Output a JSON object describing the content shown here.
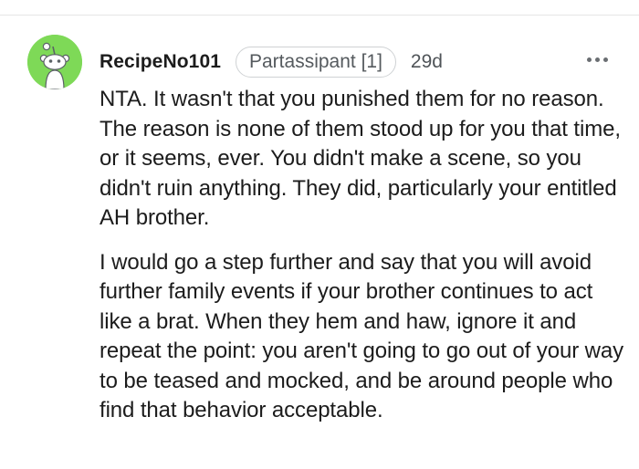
{
  "comment": {
    "username": "RecipeNo101",
    "flair": "Partassipant [1]",
    "timestamp": "29d",
    "more_icon": "more-horizontal-icon",
    "avatar_color": "#7ed957",
    "paragraphs": [
      "NTA. It wasn't that you punished them for no reason. The reason is none of them stood up for you that time, or it seems, ever. You didn't make a scene, so you didn't ruin anything. They did, particularly your entitled AH brother.",
      "I would go a step further and say that you will avoid further family events if your brother continues to act like a brat. When they hem and haw, ignore it and repeat the point: you aren't going to go out of your way to be teased and mocked, and be around people who find that behavior acceptable."
    ]
  }
}
